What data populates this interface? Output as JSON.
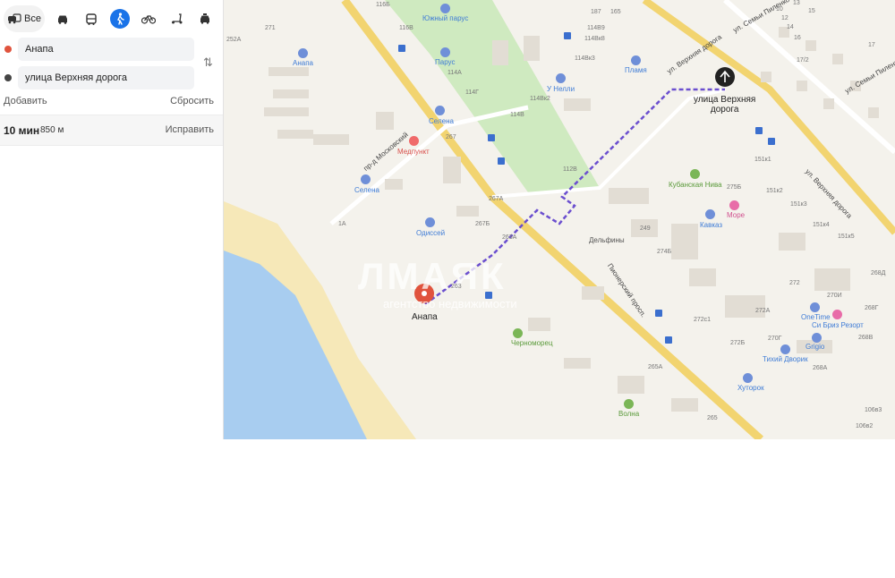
{
  "modes": {
    "all_label": "Все",
    "items": [
      {
        "name": "car-icon"
      },
      {
        "name": "bus-icon"
      },
      {
        "name": "walk-icon",
        "active": true
      },
      {
        "name": "bicycle-icon"
      },
      {
        "name": "scooter-icon"
      },
      {
        "name": "taxi-icon"
      }
    ]
  },
  "route": {
    "from": "Анапа",
    "to": "улица Верхняя дорога",
    "add_label": "Добавить",
    "reset_label": "Сбросить",
    "time": "10 мин",
    "distance": "850 м",
    "fix_label": "Исправить"
  },
  "colors": {
    "accent": "#1a73e8",
    "route": "#6b4fcf",
    "from_dot": "#e0533d",
    "to_dot": "#444444",
    "sea": "#a8cdf0",
    "beach": "#f6e8b8"
  },
  "map": {
    "start_label": "Анапа",
    "end_label_line1": "улица Верхняя",
    "end_label_line2": "дорога",
    "watermark": "ЛМАЯК",
    "watermark_sub": "агентство недвижимости",
    "streets": {
      "verkhnyaya_top": "ул. Верхняя дорога",
      "verkhnyaya_right": "ул. Верхняя дорога",
      "pionersky": "Пионерский просп.",
      "moskovsky": "пр-д Московский",
      "semyi_pilenko_top": "ул. Семьи Пиленко",
      "semyi_pilenko_right": "ул. Семьи Пиленко"
    },
    "pois": {
      "anapa_top": "Анапа",
      "yuzhny_parus": "Южный парус",
      "parus": "Парус",
      "plamya": "Пламя",
      "u_nelli": "У Нелли",
      "selena_top": "Селена",
      "medpunkt": "Медпункт",
      "selena_left": "Селена",
      "odissey": "Одиссей",
      "kubanskaya_niva": "Кубанская Нива",
      "more": "Море",
      "kavkaz": "Кавказ",
      "delfiny": "Дельфины",
      "chernomorets": "Черноморец",
      "volna": "Волна",
      "onetime": "OneTime",
      "si_briz": "Си Бриз Резорт",
      "grigio": "Grigio",
      "tikhy_dvorik": "Тихий Дворик",
      "khutorok": "Хуторок"
    },
    "numbers": {
      "n116b": "116Б",
      "n116v": "116В",
      "n271": "271",
      "n252a": "252А",
      "n114a": "114А",
      "n114g": "114Г",
      "n114v": "114В",
      "n114v2": "114Вк2",
      "n114v9": "114В9",
      "n114vk": "114Вк8",
      "n114vk3": "114Вк3",
      "n187": "187",
      "n165": "165",
      "n267": "267",
      "n267a": "267А",
      "n267b": "267Б",
      "n263a": "263А",
      "n263": "263",
      "n112v": "112В",
      "n1a": "1А",
      "n249": "249",
      "n274b": "274Б",
      "n275b": "275Б",
      "n151k1": "151к1",
      "n151k2": "151к2",
      "n151k3": "151к3",
      "n151k4": "151к4",
      "n151k5": "151к5",
      "n272": "272",
      "n270i": "270И",
      "n268d": "268Д",
      "n268g": "268Г",
      "n268v": "268В",
      "n272a": "272А",
      "n272v1": "272с1",
      "n270g": "270Г",
      "n272b": "272Б",
      "n268a": "268А",
      "n265a": "265А",
      "n265": "265",
      "n106v3": "106в3",
      "n106v2": "106в2",
      "n10": "10",
      "n12": "12",
      "n14": "14",
      "n15": "15",
      "n16": "16",
      "n13": "13",
      "n17": "17",
      "n17v2": "17/2"
    }
  }
}
